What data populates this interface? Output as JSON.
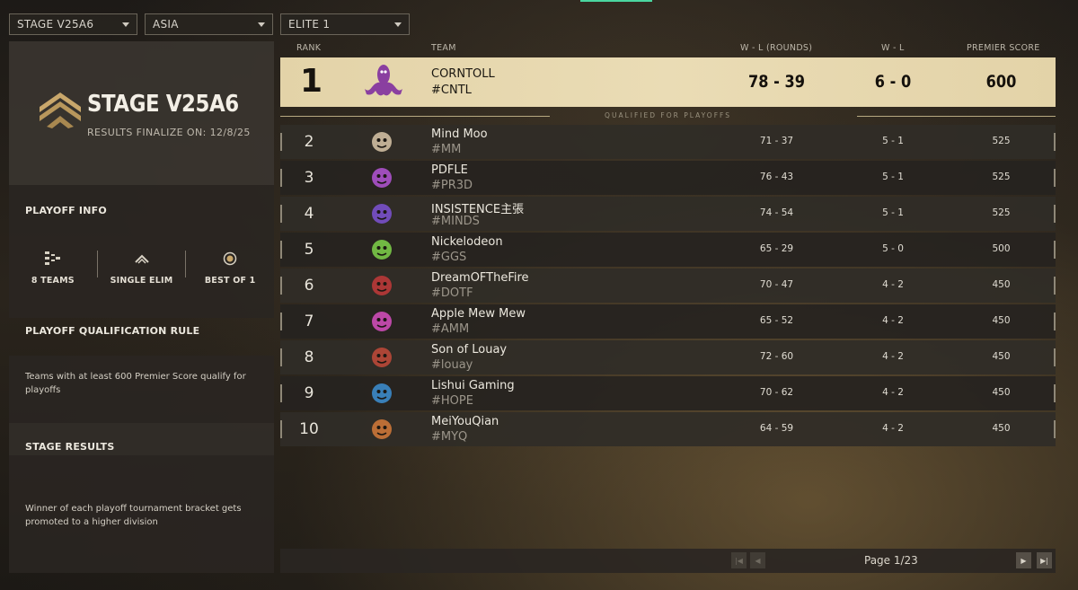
{
  "filters": [
    {
      "value": "STAGE V25A6"
    },
    {
      "value": "ASIA"
    },
    {
      "value": "ELITE 1"
    }
  ],
  "stage": {
    "title": "STAGE V25A6",
    "finalize": "RESULTS FINALIZE ON: 12/8/25"
  },
  "playoff_info": {
    "heading": "PLAYOFF INFO",
    "items": [
      {
        "label": "8 TEAMS",
        "icon": "bracket-icon"
      },
      {
        "label": "SINGLE ELIM",
        "icon": "chevron-up-icon"
      },
      {
        "label": "BEST OF 1",
        "icon": "target-icon"
      }
    ]
  },
  "qualification": {
    "heading": "PLAYOFF QUALIFICATION RULE",
    "text": "Teams with at least 600 Premier Score qualify for playoffs"
  },
  "stage_results": {
    "heading": "STAGE RESULTS",
    "text": "Winner of each playoff tournament bracket gets promoted to a higher division"
  },
  "table": {
    "headers": {
      "rank": "RANK",
      "team": "TEAM",
      "wl_rounds": "W - L (ROUNDS)",
      "wl": "W - L",
      "score": "PREMIER SCORE"
    },
    "qualified_label": "QUALIFIED FOR PLAYOFFS",
    "rows": [
      {
        "rank": "1",
        "name": "CORNTOLL",
        "tag": "#CNTL",
        "wl_rounds": "78 - 39",
        "wl": "6 - 0",
        "score": "600",
        "logo": "purple-octopus-logo",
        "color": "#8a3fa0"
      },
      {
        "rank": "2",
        "name": "Mind Moo",
        "tag": "#MM",
        "wl_rounds": "71 - 37",
        "wl": "5 - 1",
        "score": "525",
        "logo": "boba-cup-logo",
        "color": "#d8c6a8"
      },
      {
        "rank": "3",
        "name": "PDFLE",
        "tag": "#PR3D",
        "wl_rounds": "76 - 43",
        "wl": "5 - 1",
        "score": "525",
        "logo": "heart-logo",
        "color": "#b455d6"
      },
      {
        "rank": "4",
        "name": "INSISTENCE主張",
        "tag": "#MINDS",
        "wl_rounds": "74 - 54",
        "wl": "5 - 1",
        "score": "525",
        "logo": "purple-creature-logo",
        "color": "#7c52d4"
      },
      {
        "rank": "5",
        "name": "Nickelodeon",
        "tag": "#GGS",
        "wl_rounds": "65 - 29",
        "wl": "5 - 0",
        "score": "500",
        "logo": "green-octopus-logo",
        "color": "#7fd24a"
      },
      {
        "rank": "6",
        "name": "DreamOFTheFire",
        "tag": "#DOTF",
        "wl_rounds": "70 - 47",
        "wl": "4 - 2",
        "score": "450",
        "logo": "red-star-logo",
        "color": "#c23a3a"
      },
      {
        "rank": "7",
        "name": "Apple Mew Mew",
        "tag": "#AMM",
        "wl_rounds": "65 - 52",
        "wl": "4 - 2",
        "score": "450",
        "logo": "pink-cat-logo",
        "color": "#d74fc0"
      },
      {
        "rank": "8",
        "name": "Son of Louay",
        "tag": "#louay",
        "wl_rounds": "72 - 60",
        "wl": "4 - 2",
        "score": "450",
        "logo": "red-crest-logo",
        "color": "#c24a3a"
      },
      {
        "rank": "9",
        "name": "Lishui Gaming",
        "tag": "#HOPE",
        "wl_rounds": "70 - 62",
        "wl": "4 - 2",
        "score": "450",
        "logo": "blue-wave-logo",
        "color": "#3d8fd4"
      },
      {
        "rank": "10",
        "name": "MeiYouQian",
        "tag": "#MYQ",
        "wl_rounds": "64 - 59",
        "wl": "4 - 2",
        "score": "450",
        "logo": "orange-octopus-logo",
        "color": "#d47a3a"
      }
    ]
  },
  "pager": {
    "text": "Page 1/23"
  },
  "colors": {
    "first_place_bg": "#e3d3a8",
    "accent": "#4ad6a0"
  }
}
